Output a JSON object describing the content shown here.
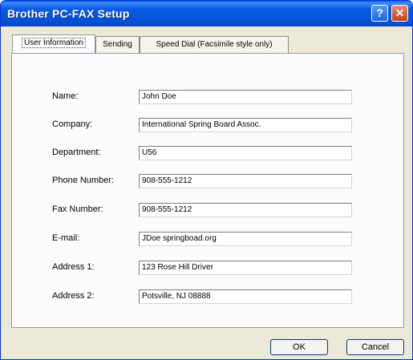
{
  "window": {
    "title": "Brother PC-FAX Setup"
  },
  "titlebar_buttons": {
    "help": "?",
    "close": "✕"
  },
  "tabs": [
    {
      "label": "User Information",
      "active": true
    },
    {
      "label": "Sending",
      "active": false
    },
    {
      "label": "Speed Dial (Facsimile style only)",
      "active": false
    }
  ],
  "fields": [
    {
      "label": "Name:",
      "value": "John Doe"
    },
    {
      "label": "Company:",
      "value": "International Spring Board Assoc."
    },
    {
      "label": "Department:",
      "value": "U56"
    },
    {
      "label": "Phone Number:",
      "value": "908-555-1212"
    },
    {
      "label": "Fax Number:",
      "value": "908-555-1212"
    },
    {
      "label": "E-mail:",
      "value": "JDoe springboad.org"
    },
    {
      "label": "Address 1:",
      "value": "123 Rose Hill Driver"
    },
    {
      "label": "Address 2:",
      "value": "Potsville, NJ 08888"
    }
  ],
  "buttons": {
    "ok": "OK",
    "cancel": "Cancel"
  }
}
